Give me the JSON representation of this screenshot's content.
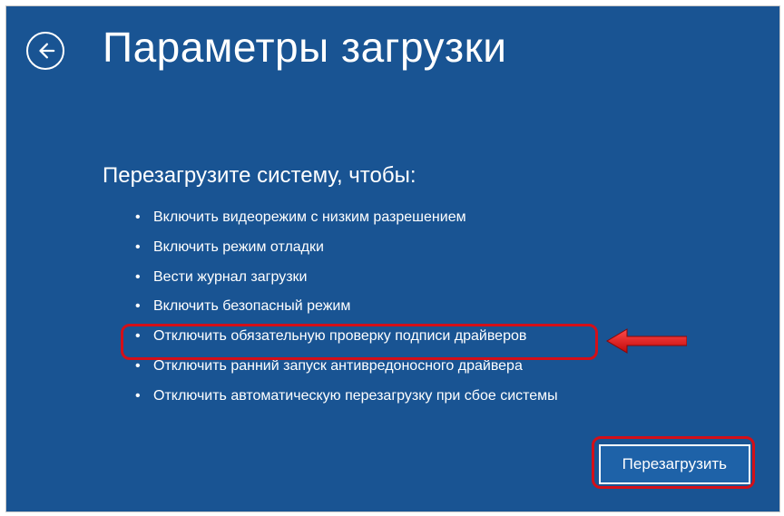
{
  "title": "Параметры загрузки",
  "subtitle": "Перезагрузите систему, чтобы:",
  "options": [
    "Включить видеорежим с низким разрешением",
    "Включить режим отладки",
    "Вести журнал загрузки",
    "Включить безопасный режим",
    "Отключить обязательную проверку подписи драйверов",
    "Отключить ранний запуск антивредоносного драйвера",
    "Отключить автоматическую перезагрузку при сбое системы"
  ],
  "restart_label": "Перезагрузить",
  "highlight_index": 4,
  "colors": {
    "bg": "#195493",
    "accent": "#d40f18",
    "btn": "#1e62a8"
  }
}
